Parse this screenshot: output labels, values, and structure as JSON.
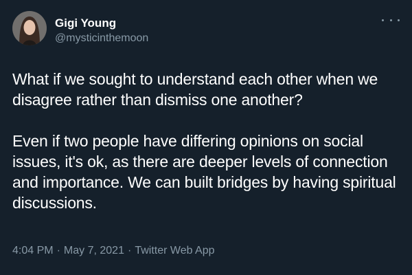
{
  "author": {
    "display_name": "Gigi Young",
    "handle": "@mysticinthemoon"
  },
  "tweet": {
    "paragraph_1": "What if we sought to understand each other when we disagree rather than dismiss one another?",
    "paragraph_2": "Even if two people have differing opinions on social issues, it's ok, as there are deeper levels of connection and importance. We can built bridges by having spiritual discussions."
  },
  "meta": {
    "time": "4:04 PM",
    "separator": "·",
    "date": "May 7, 2021",
    "source": "Twitter Web App"
  },
  "icons": {
    "more": "more-options-icon"
  },
  "colors": {
    "background": "#15202b",
    "text": "#ffffff",
    "secondary": "#8899a6"
  }
}
